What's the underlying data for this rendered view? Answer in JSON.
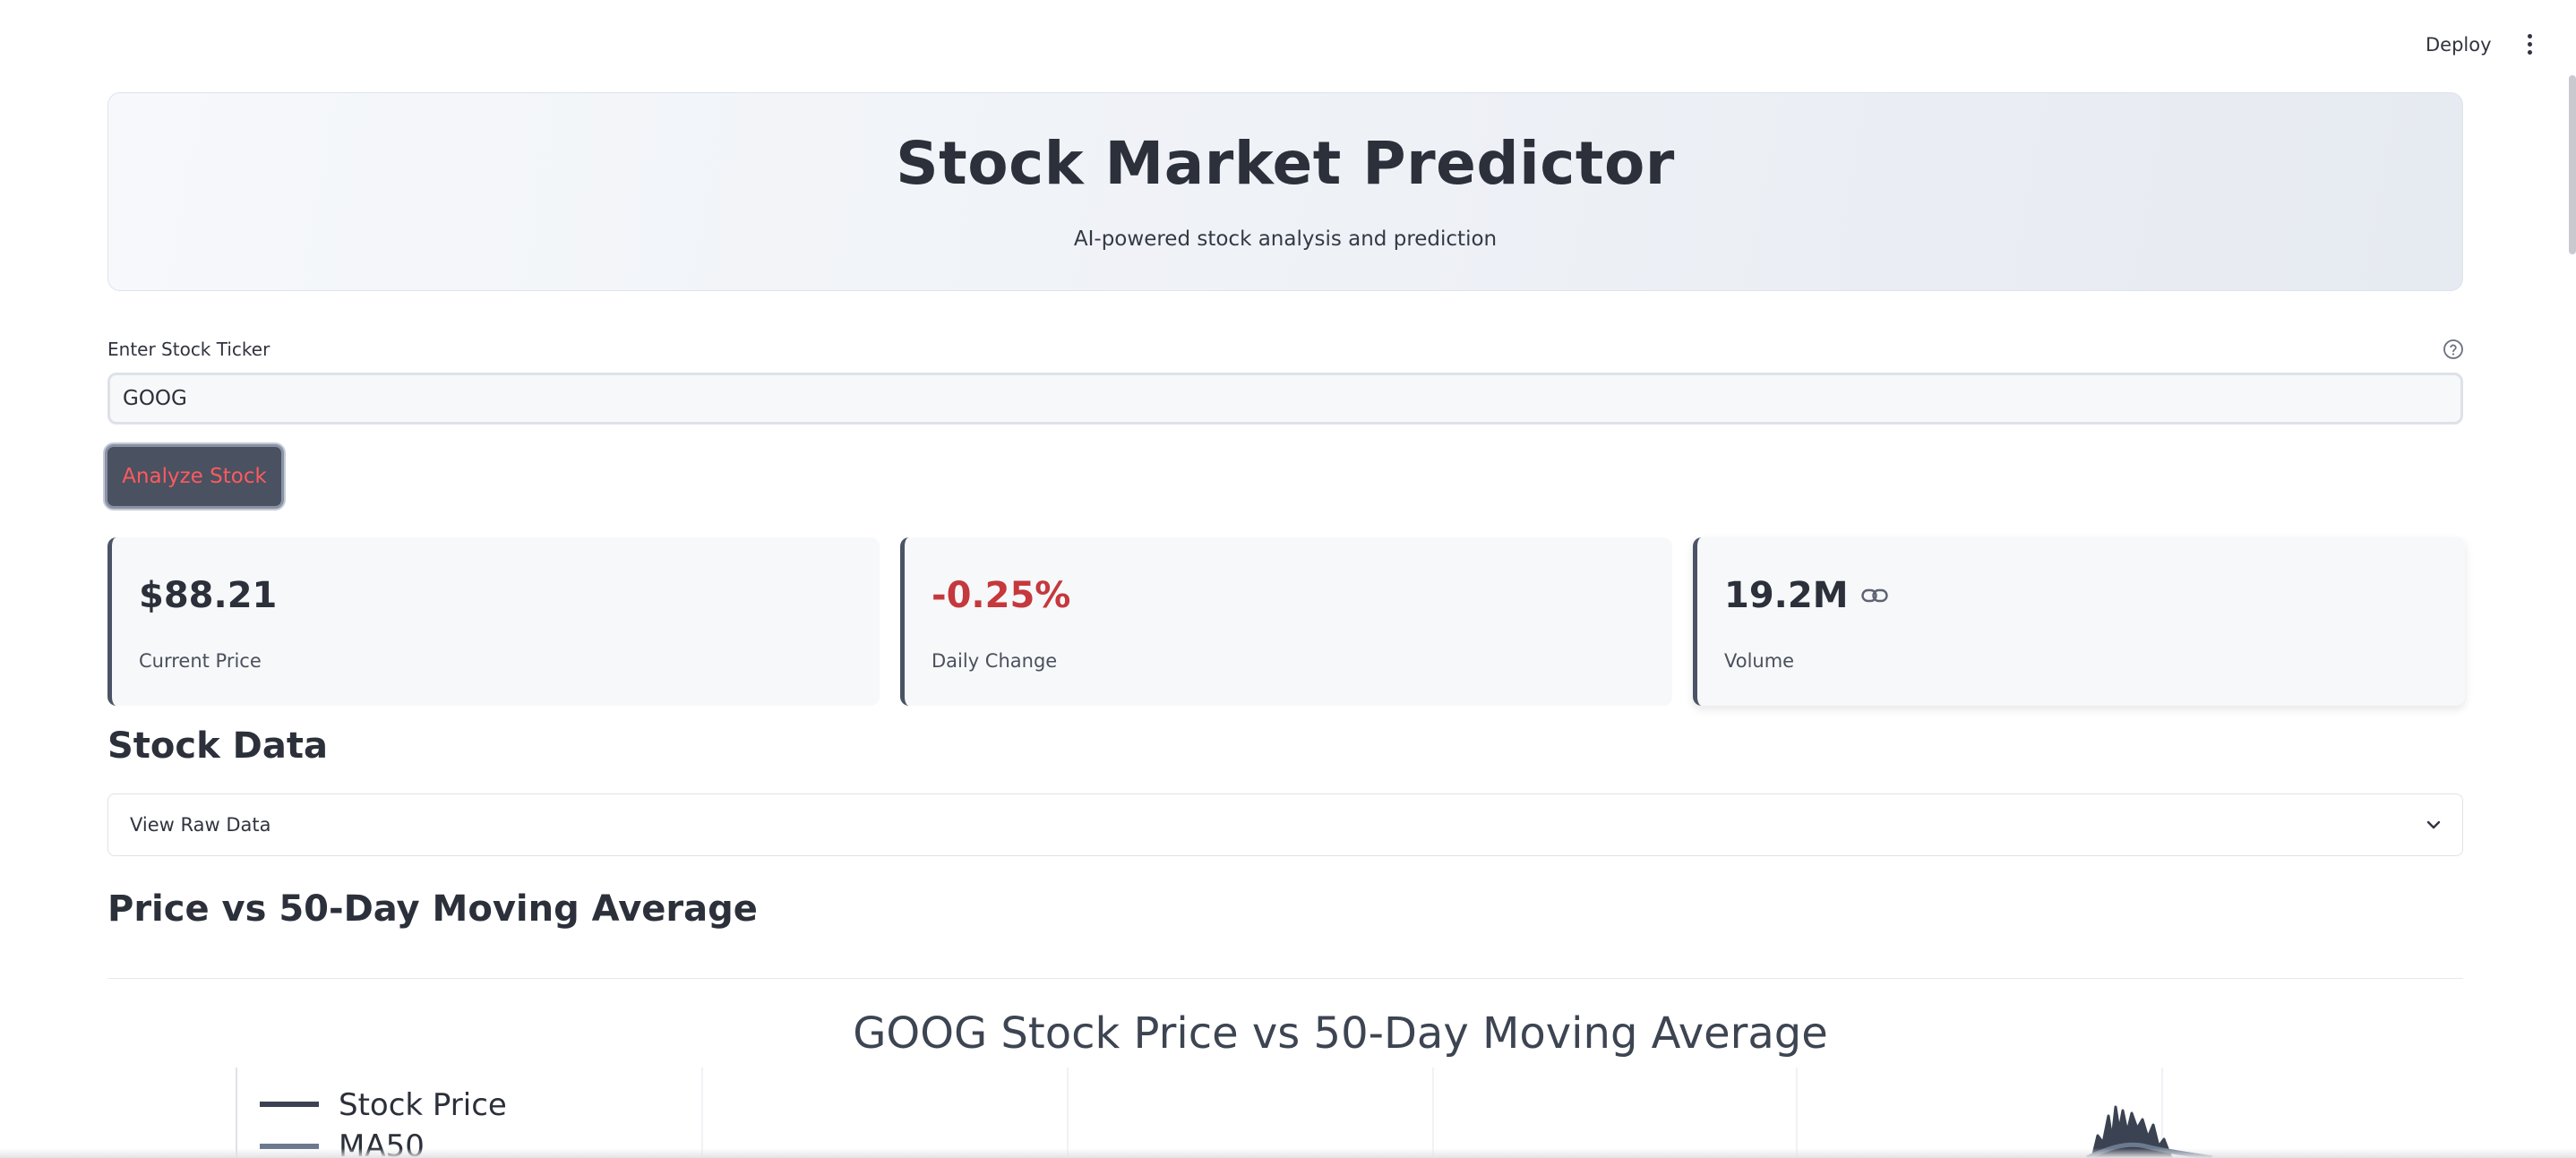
{
  "toolbar": {
    "deploy_label": "Deploy",
    "menu_icon": "more-vertical-icon"
  },
  "header": {
    "title": "Stock Market Predictor",
    "subtitle": "AI-powered stock analysis and prediction"
  },
  "ticker_input": {
    "label": "Enter Stock Ticker",
    "value": "GOOG",
    "help_icon": "question-circle-icon"
  },
  "analyze_button": {
    "label": "Analyze Stock",
    "text_color": "#ff5a5f"
  },
  "metrics": [
    {
      "value": "$88.21",
      "label": "Current Price"
    },
    {
      "value": "-0.25%",
      "label": "Daily Change",
      "value_color": "#c5383c"
    },
    {
      "value": "19.2M",
      "label": "Volume",
      "icon": "link-icon"
    }
  ],
  "stock_data": {
    "title": "Stock Data",
    "expander_label": "View Raw Data"
  },
  "moving_average": {
    "title": "Price vs 50-Day Moving Average"
  },
  "chart_data": {
    "type": "line",
    "title": "GOOG Stock Price vs 50-Day Moving Average",
    "series": [
      {
        "name": "Stock Price",
        "color": "#3b4252"
      },
      {
        "name": "MA50",
        "color": "#6c7a8f"
      }
    ],
    "legend_position": "top-left",
    "grid": true
  }
}
